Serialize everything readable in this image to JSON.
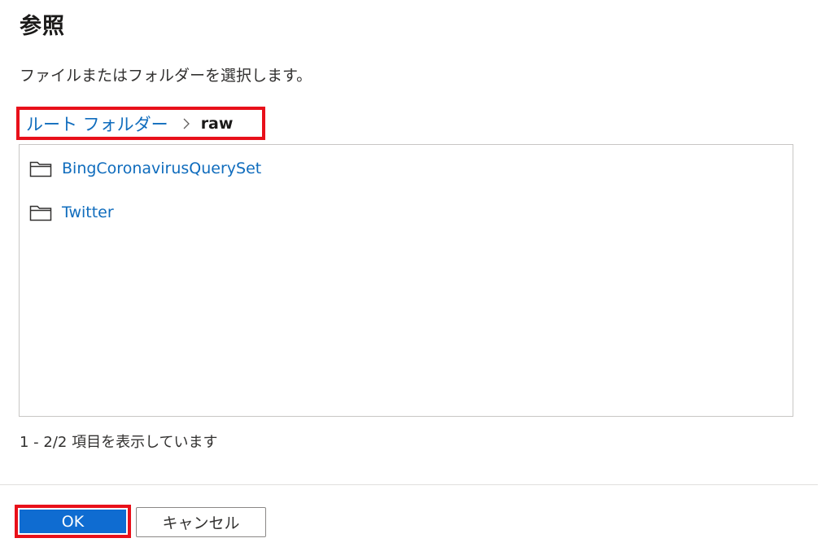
{
  "dialog": {
    "title": "参照",
    "subtitle": "ファイルまたはフォルダーを選択します。"
  },
  "breadcrumb": {
    "root_label": "ルート フォルダー",
    "separator_icon": "chevron-right-icon",
    "current_label": "raw"
  },
  "list": {
    "items": [
      {
        "label": "BingCoronavirusQuerySet",
        "icon": "folder-icon"
      },
      {
        "label": "Twitter",
        "icon": "folder-icon"
      }
    ]
  },
  "status": {
    "text": "1 - 2/2 項目を表示しています"
  },
  "footer": {
    "ok_label": "OK",
    "cancel_label": "キャンセル"
  },
  "colors": {
    "accent": "#0f6cd1",
    "link": "#0f6cbd",
    "highlight": "#e8101a"
  }
}
